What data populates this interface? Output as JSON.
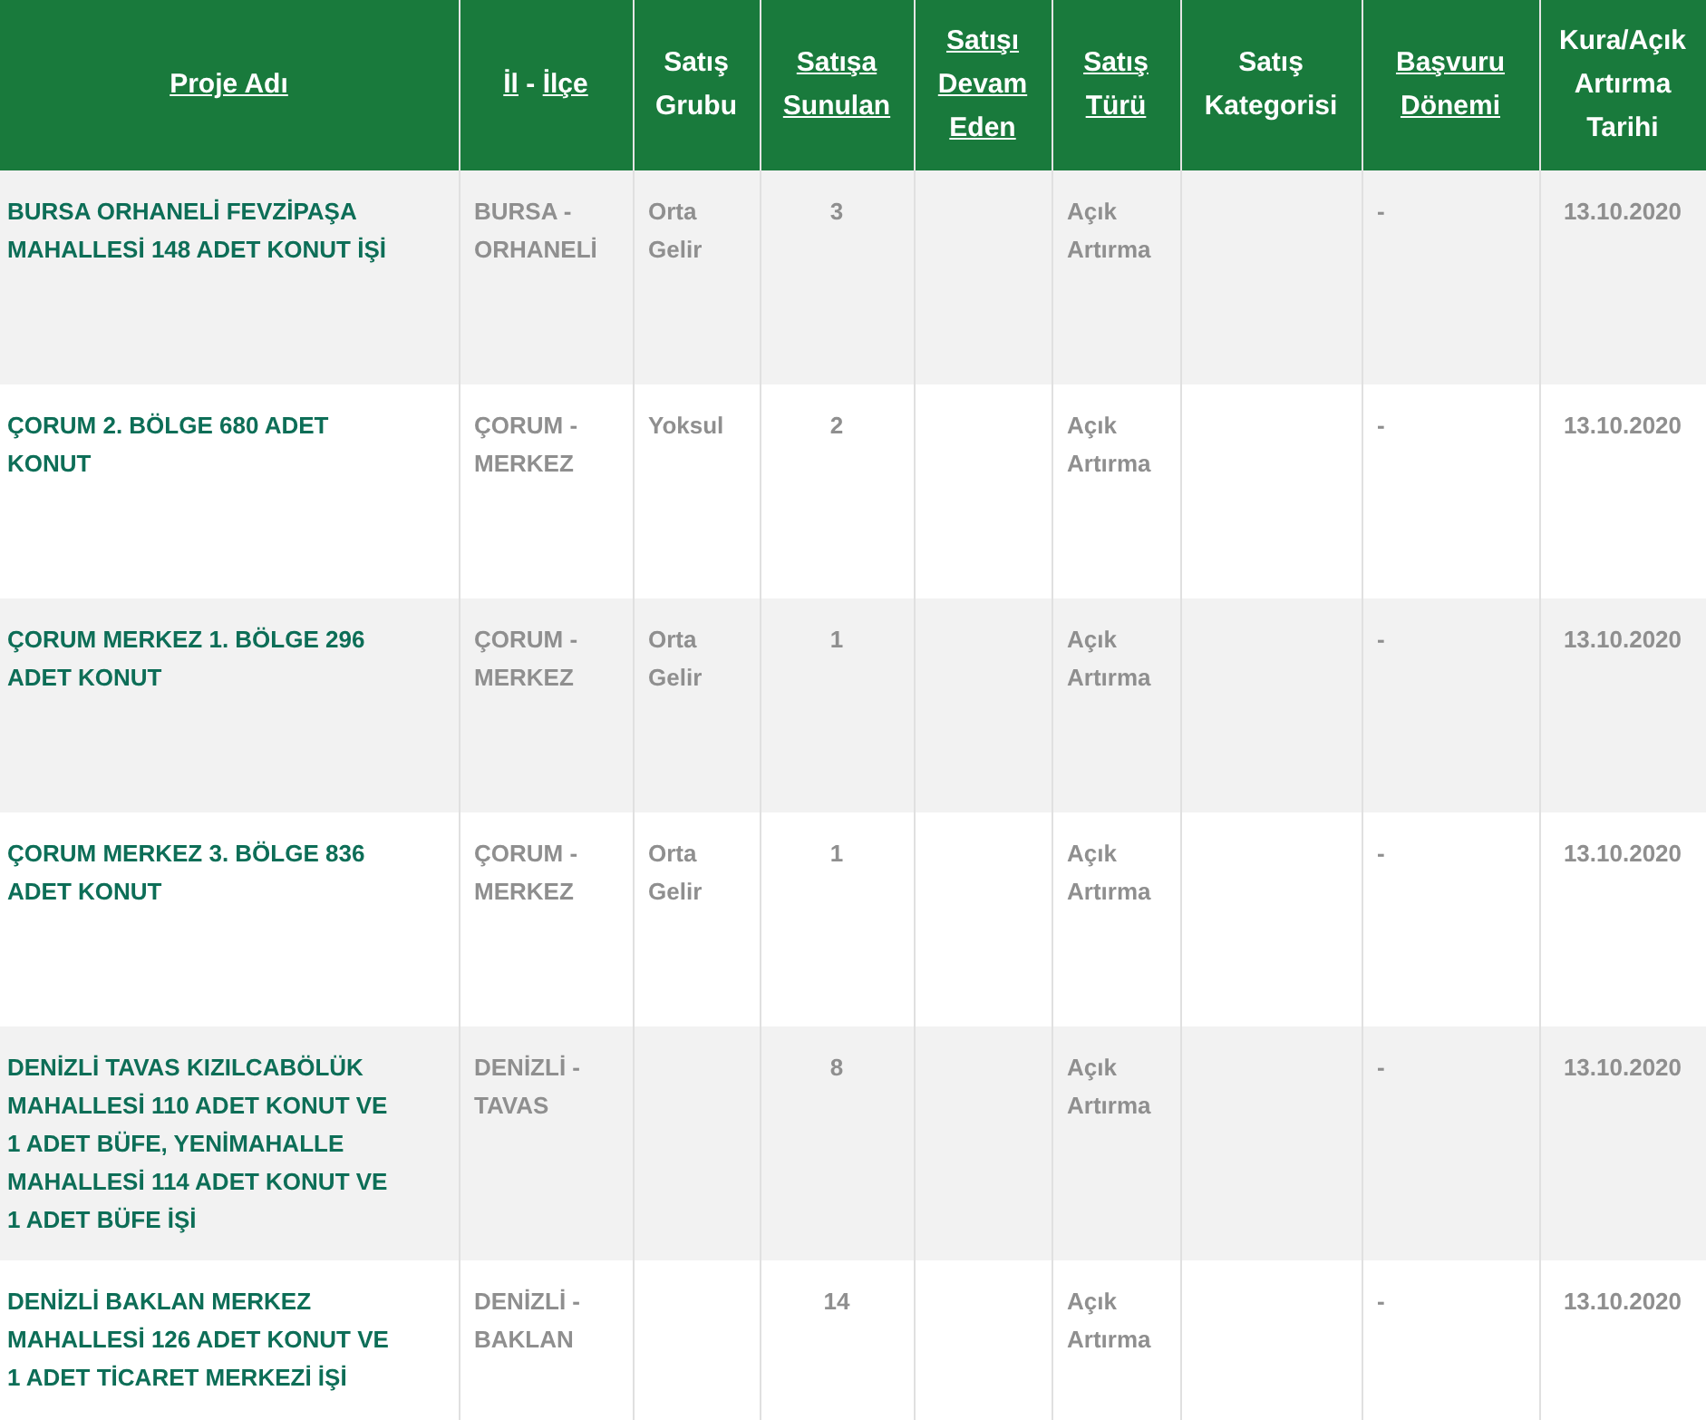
{
  "table": {
    "columns": [
      {
        "parts": [
          {
            "text": "Proje Adı",
            "link": true
          }
        ]
      },
      {
        "parts": [
          {
            "text": "İl",
            "link": true
          },
          {
            "text": "-",
            "link": false
          },
          {
            "text": "İlçe",
            "link": true
          }
        ]
      },
      {
        "parts": [
          {
            "text": "Satış Grubu",
            "link": false
          }
        ]
      },
      {
        "parts": [
          {
            "text": "Satışa Sunulan",
            "link": true
          }
        ]
      },
      {
        "parts": [
          {
            "text": "Satışı Devam Eden",
            "link": true
          }
        ]
      },
      {
        "parts": [
          {
            "text": "Satış Türü",
            "link": true
          }
        ]
      },
      {
        "parts": [
          {
            "text": "Satış Kategorisi",
            "link": false
          }
        ]
      },
      {
        "parts": [
          {
            "text": "Başvuru Dönemi",
            "link": true
          }
        ]
      },
      {
        "parts": [
          {
            "text": "Kura/Açık Artırma Tarihi",
            "link": false
          }
        ]
      }
    ],
    "rows": [
      {
        "cells": [
          "BURSA ORHANELİ FEVZİPAŞA MAHALLESİ 148 ADET KONUT İŞİ",
          "BURSA - ORHANELİ",
          "Orta Gelir",
          "3",
          "",
          "Açık Artırma",
          "",
          "-",
          "13.10.2020"
        ]
      },
      {
        "cells": [
          "ÇORUM 2. BÖLGE 680 ADET KONUT",
          "ÇORUM - MERKEZ",
          "Yoksul",
          "2",
          "",
          "Açık Artırma",
          "",
          "-",
          "13.10.2020"
        ]
      },
      {
        "cells": [
          "ÇORUM MERKEZ 1. BÖLGE 296 ADET KONUT",
          "ÇORUM - MERKEZ",
          "Orta Gelir",
          "1",
          "",
          "Açık Artırma",
          "",
          "-",
          "13.10.2020"
        ]
      },
      {
        "cells": [
          "ÇORUM MERKEZ 3. BÖLGE 836 ADET KONUT",
          "ÇORUM - MERKEZ",
          "Orta Gelir",
          "1",
          "",
          "Açık Artırma",
          "",
          "-",
          "13.10.2020"
        ]
      },
      {
        "cells": [
          "DENİZLİ TAVAS KIZILCABÖLÜK MAHALLESİ 110 ADET KONUT VE 1 ADET BÜFE, YENİMAHALLE MAHALLESİ 114 ADET KONUT VE 1 ADET BÜFE İŞİ",
          "DENİZLİ - TAVAS",
          "",
          "8",
          "",
          "Açık Artırma",
          "",
          "-",
          "13.10.2020"
        ]
      },
      {
        "cells": [
          "DENİZLİ BAKLAN MERKEZ MAHALLESİ 126 ADET KONUT VE 1 ADET TİCARET MERKEZİ İŞİ",
          "DENİZLİ - BAKLAN",
          "",
          "14",
          "",
          "Açık Artırma",
          "",
          "-",
          "13.10.2020"
        ]
      }
    ]
  }
}
